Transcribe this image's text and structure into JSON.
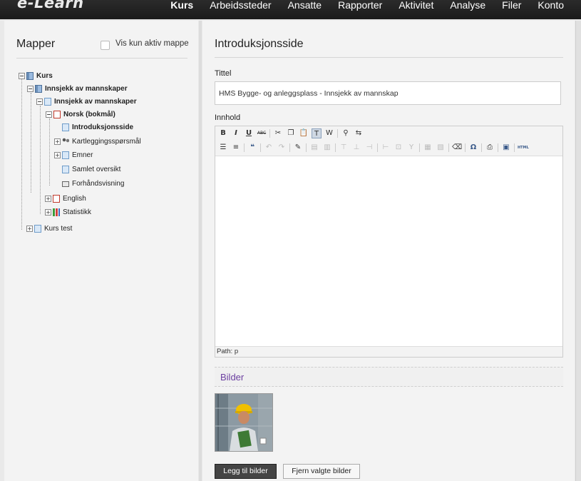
{
  "app": {
    "logo": "e-Learn"
  },
  "nav": [
    "Kurs",
    "Arbeidssteder",
    "Ansatte",
    "Rapporter",
    "Aktivitet",
    "Analyse",
    "Filer",
    "Konto"
  ],
  "sidebar": {
    "title": "Mapper",
    "filter_label": "Vis kun aktiv mappe",
    "tree": {
      "kurs": "Kurs",
      "innsjekk1": "Innsjekk av mannskaper",
      "innsjekk2": "Innsjekk av mannskaper",
      "norsk": "Norsk (bokmål)",
      "intro": "Introduksjonsside",
      "kartlegging": "Kartleggingsspørsmål",
      "emner": "Emner",
      "samlet": "Samlet oversikt",
      "forhand": "Forhåndsvisning",
      "english": "English",
      "statistikk": "Statistikk",
      "kurs_test": "Kurs test"
    }
  },
  "main": {
    "title": "Introduksjonsside",
    "tittel_label": "Tittel",
    "tittel_value": "HMS Bygge- og anleggsplass - Innsjekk av mannskap",
    "innhold_label": "Innhold",
    "path": "Path: p",
    "bilder": "Bilder",
    "add_images": "Legg til bilder",
    "remove_images": "Fjern valgte bilder"
  },
  "toolbar": {
    "bold": "B",
    "italic": "I",
    "underline": "U",
    "strike": "ABC",
    "html": "HTML"
  },
  "colors": {
    "topbar": "#1f1f1f",
    "accent_purple": "#6b3fa0",
    "panel": "#f3f3f3"
  }
}
